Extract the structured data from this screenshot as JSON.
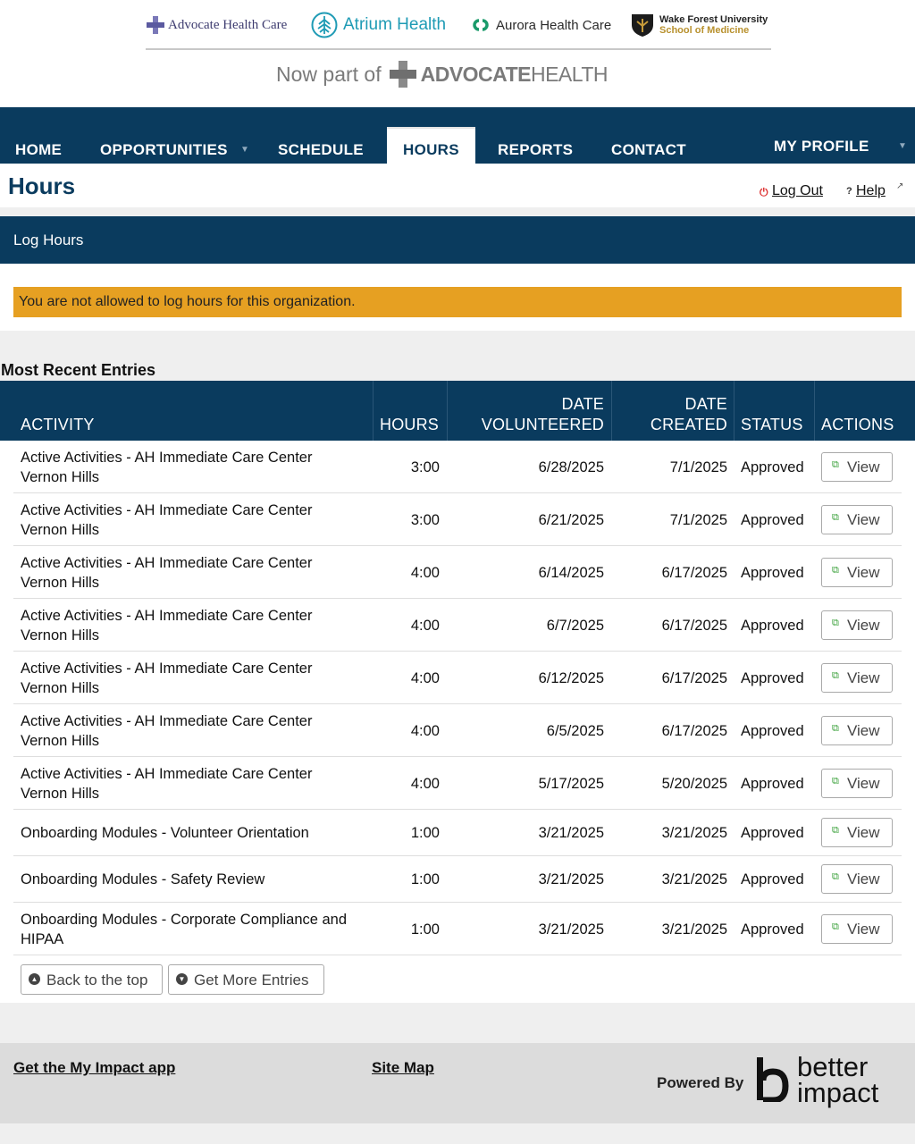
{
  "header": {
    "logos": {
      "advocate": "Advocate Health Care",
      "atrium": "Atrium Health",
      "aurora": "Aurora Health Care",
      "wfu_line1": "Wake Forest University",
      "wfu_line2": "School of Medicine"
    },
    "now_part_of": "Now part of",
    "advocate_bold": "ADVOCATE",
    "advocate_light": "HEALTH"
  },
  "nav": {
    "home": "HOME",
    "opportunities": "OPPORTUNITIES",
    "schedule": "SCHEDULE",
    "hours": "HOURS",
    "reports": "REPORTS",
    "contact": "CONTACT",
    "my_profile": "MY PROFILE",
    "active_tab": "HOURS"
  },
  "page": {
    "title": "Hours",
    "logout": "Log Out",
    "help": "Help"
  },
  "log_hours": {
    "heading": "Log Hours",
    "warning": "You are not allowed to log hours for this organization."
  },
  "entries": {
    "title": "Most Recent Entries",
    "columns": {
      "activity": "ACTIVITY",
      "hours": "HOURS",
      "date_vol_1": "DATE",
      "date_vol_2": "VOLUNTEERED",
      "date_cr_1": "DATE",
      "date_cr_2": "CREATED",
      "status": "STATUS",
      "actions": "ACTIONS"
    },
    "view_label": "View",
    "rows": [
      {
        "activity_1": "Active Activities - AH Immediate Care Center",
        "activity_2": "Vernon Hills",
        "hours": "3:00",
        "date_volunteered": "6/28/2025",
        "date_created": "7/1/2025",
        "status": "Approved"
      },
      {
        "activity_1": "Active Activities - AH Immediate Care Center",
        "activity_2": "Vernon Hills",
        "hours": "3:00",
        "date_volunteered": "6/21/2025",
        "date_created": "7/1/2025",
        "status": "Approved"
      },
      {
        "activity_1": "Active Activities - AH Immediate Care Center",
        "activity_2": "Vernon Hills",
        "hours": "4:00",
        "date_volunteered": "6/14/2025",
        "date_created": "6/17/2025",
        "status": "Approved"
      },
      {
        "activity_1": "Active Activities - AH Immediate Care Center",
        "activity_2": "Vernon Hills",
        "hours": "4:00",
        "date_volunteered": "6/7/2025",
        "date_created": "6/17/2025",
        "status": "Approved"
      },
      {
        "activity_1": "Active Activities - AH Immediate Care Center",
        "activity_2": "Vernon Hills",
        "hours": "4:00",
        "date_volunteered": "6/12/2025",
        "date_created": "6/17/2025",
        "status": "Approved"
      },
      {
        "activity_1": "Active Activities - AH Immediate Care Center",
        "activity_2": "Vernon Hills",
        "hours": "4:00",
        "date_volunteered": "6/5/2025",
        "date_created": "6/17/2025",
        "status": "Approved"
      },
      {
        "activity_1": "Active Activities - AH Immediate Care Center",
        "activity_2": "Vernon Hills",
        "hours": "4:00",
        "date_volunteered": "5/17/2025",
        "date_created": "5/20/2025",
        "status": "Approved"
      },
      {
        "activity_1": "Onboarding Modules - Volunteer Orientation",
        "activity_2": "",
        "hours": "1:00",
        "date_volunteered": "3/21/2025",
        "date_created": "3/21/2025",
        "status": "Approved"
      },
      {
        "activity_1": "Onboarding Modules - Safety Review",
        "activity_2": "",
        "hours": "1:00",
        "date_volunteered": "3/21/2025",
        "date_created": "3/21/2025",
        "status": "Approved"
      },
      {
        "activity_1": "Onboarding Modules - Corporate Compliance and",
        "activity_2": "HIPAA",
        "hours": "1:00",
        "date_volunteered": "3/21/2025",
        "date_created": "3/21/2025",
        "status": "Approved"
      }
    ],
    "back_to_top": "Back to the top",
    "get_more": "Get More Entries"
  },
  "footer": {
    "app_link": "Get the My Impact app",
    "site_map": "Site Map",
    "powered_by": "Powered By",
    "brand_1": "better",
    "brand_2": "impact"
  }
}
